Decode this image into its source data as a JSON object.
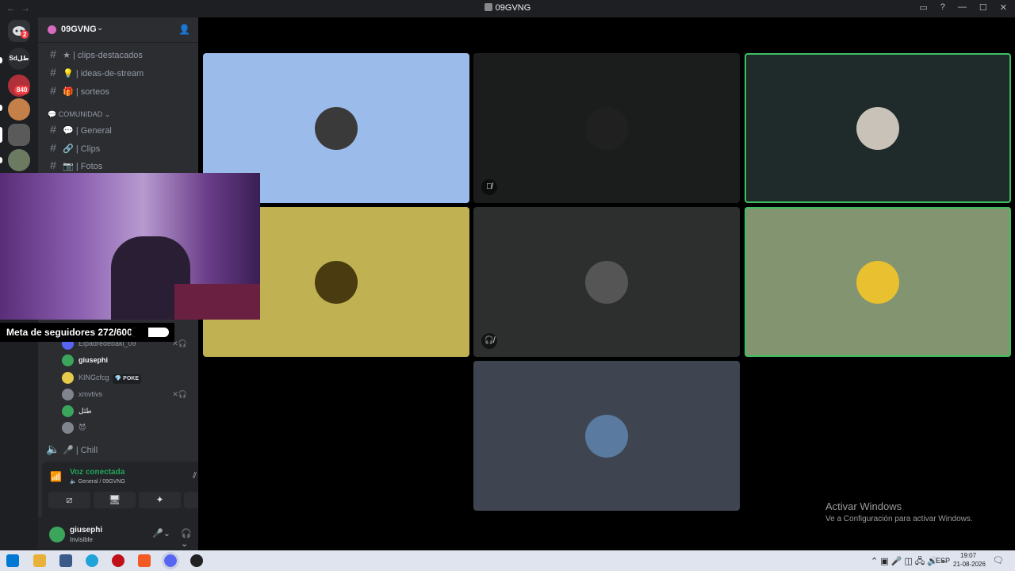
{
  "window": {
    "title": "09GVNG",
    "back": "←",
    "forward": "→"
  },
  "servers": {
    "dm_badge": "2",
    "server_2_label": "Sdطل",
    "server_3_badge": "840"
  },
  "guild": {
    "name": "09GVNG"
  },
  "channels": {
    "top": [
      {
        "emoji": "★",
        "label": "| clips-destacados"
      },
      {
        "emoji": "💡",
        "label": "| ideas-de-stream"
      },
      {
        "emoji": "🎁",
        "label": "| sorteos"
      }
    ],
    "category": "COMUNIDAD",
    "comunidad": [
      {
        "emoji": "💬",
        "label": "| General"
      },
      {
        "emoji": "🔗",
        "label": "| Clips"
      },
      {
        "emoji": "📷",
        "label": "| Fotos"
      }
    ],
    "voice_users": [
      {
        "name": "Elpadredebaki_09",
        "color": "#5865f2"
      },
      {
        "name": "giusephi",
        "color": "#3ba55c",
        "bold": true
      },
      {
        "name": "KINGcfcg",
        "color": "#e6c84a",
        "tag": "💎 POKE"
      },
      {
        "name": "xmvtivs",
        "color": "#80848e"
      },
      {
        "name": "طثل",
        "color": "#3ba55c"
      },
      {
        "name": "😈",
        "color": "#80848e"
      }
    ],
    "chill": {
      "emoji": "🎤",
      "label": "| Chill"
    }
  },
  "voice_panel": {
    "status": "Voz conectada",
    "location": "General / 09GVNG"
  },
  "user_panel": {
    "name": "giusephi",
    "status": "Invisible"
  },
  "overlay": {
    "follower_goal": "Meta de seguidores 272/600",
    "follower_current": 272,
    "follower_target": 600
  },
  "tiles": [
    {
      "bg": "#9bbcea",
      "avatar": "#3a3a3a",
      "muted": false,
      "green": false
    },
    {
      "bg": "#1b1d1d",
      "avatar": "#202020",
      "muted": true,
      "green": false
    },
    {
      "bg": "#1f2a2a",
      "avatar": "#c9c2b8",
      "muted": false,
      "green": true
    },
    {
      "bg": "#c0b152",
      "avatar": "#4a3c10",
      "muted": false,
      "green": false
    },
    {
      "bg": "#2c2f2e",
      "avatar": "#555555",
      "muted": true,
      "green": false
    },
    {
      "bg": "#829570",
      "avatar": "#e8c030",
      "muted": false,
      "green": true
    },
    {
      "bg": "#3f4550",
      "avatar": "#5a7aa0",
      "muted": false,
      "green": false
    }
  ],
  "watermark": {
    "title": "Activar Windows",
    "subtitle": "Ve a Configuración para activar Windows."
  },
  "taskbar": {
    "lang": "ESP",
    "time": "19:07",
    "date": "21-08-2026"
  }
}
